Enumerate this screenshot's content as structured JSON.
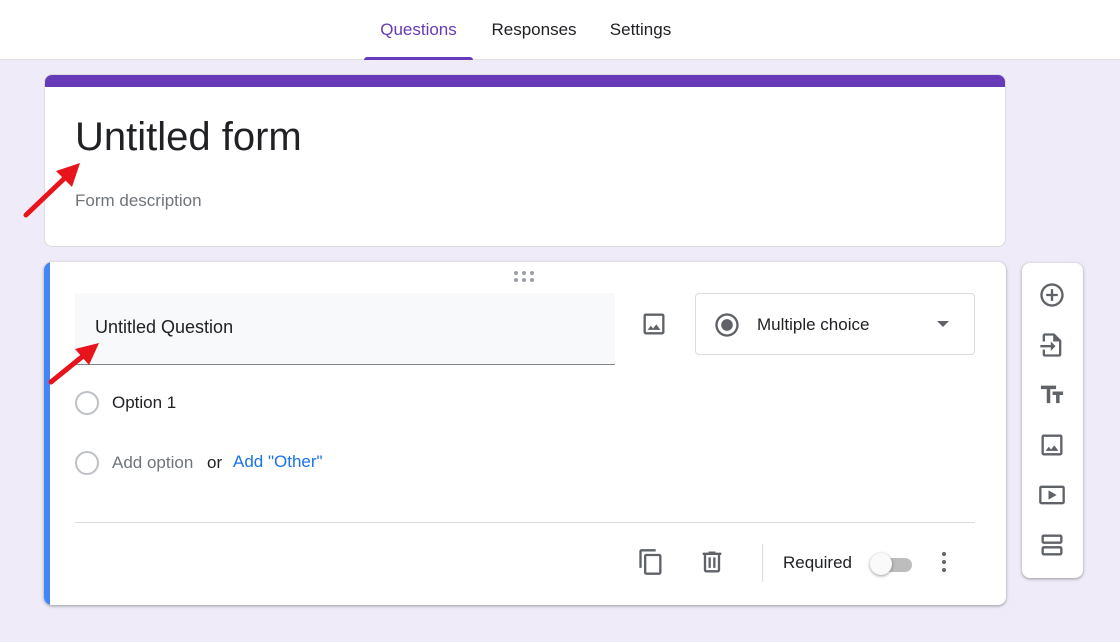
{
  "tabs": [
    {
      "label": "Questions",
      "active": true
    },
    {
      "label": "Responses",
      "active": false
    },
    {
      "label": "Settings",
      "active": false
    }
  ],
  "form": {
    "title": "Untitled form",
    "description_placeholder": "Form description"
  },
  "question": {
    "title": "Untitled Question",
    "type": "Multiple choice",
    "options": [
      "Option 1"
    ],
    "add_option_label": "Add option",
    "or_label": "or",
    "add_other_label": "Add \"Other\"",
    "required_label": "Required",
    "required_on": false
  },
  "side_toolbar": [
    "add-question-icon",
    "import-questions-icon",
    "add-title-icon",
    "add-image-icon",
    "add-video-icon",
    "add-section-icon"
  ],
  "colors": {
    "accent": "#673ab7",
    "background": "#f0ebf8",
    "active_card": "#4285f4",
    "link": "#1a73e8",
    "annotation_arrow": "#e8141b"
  }
}
